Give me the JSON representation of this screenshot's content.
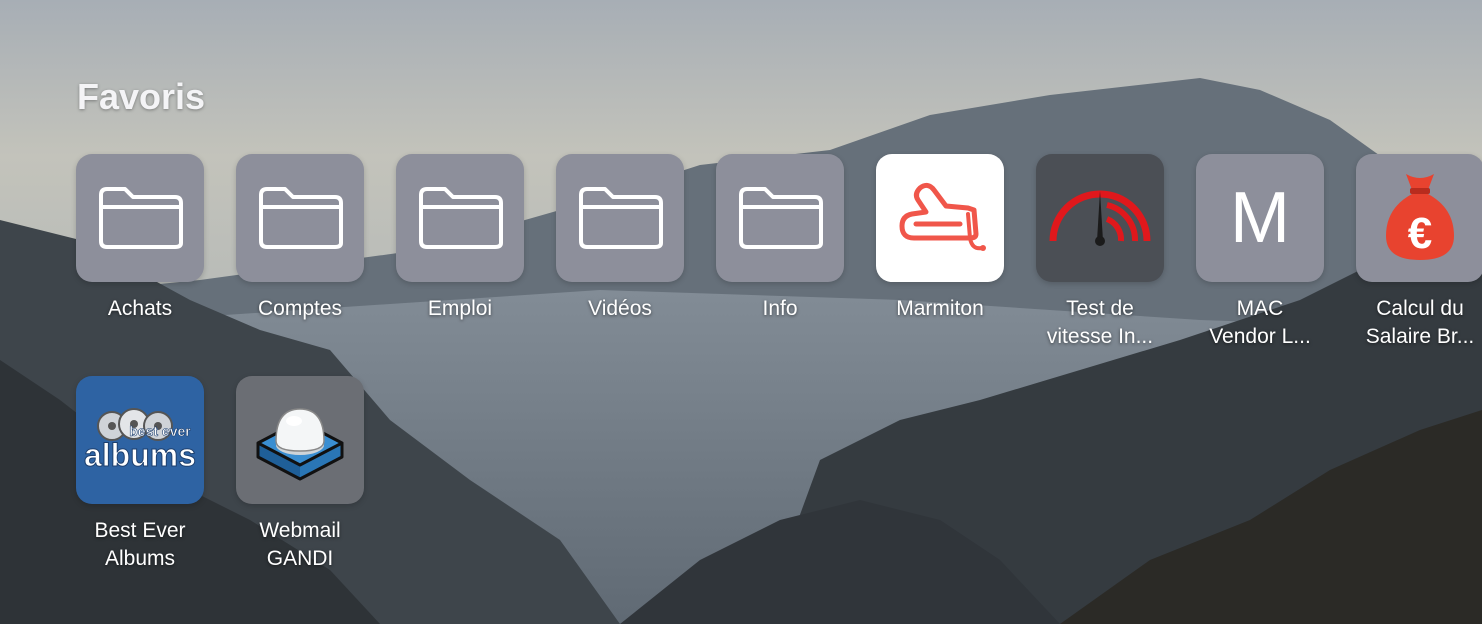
{
  "section": {
    "title": "Favoris"
  },
  "tiles": [
    {
      "label_line1": "Achats",
      "label_line2": "",
      "icon": "folder-icon"
    },
    {
      "label_line1": "Comptes",
      "label_line2": "",
      "icon": "folder-icon"
    },
    {
      "label_line1": "Emploi",
      "label_line2": "",
      "icon": "folder-icon"
    },
    {
      "label_line1": "Vidéos",
      "label_line2": "",
      "icon": "folder-icon"
    },
    {
      "label_line1": "Info",
      "label_line2": "",
      "icon": "folder-icon"
    },
    {
      "label_line1": "Marmiton",
      "label_line2": "",
      "icon": "oven-mitt-icon"
    },
    {
      "label_line1": "Test de",
      "label_line2": "vitesse In...",
      "icon": "speedometer-icon"
    },
    {
      "label_line1": "MAC",
      "label_line2": "Vendor L...",
      "icon": "letter-icon",
      "letter": "M"
    },
    {
      "label_line1": "Calcul du",
      "label_line2": "Salaire Br...",
      "icon": "euro-money-bag-icon",
      "symbol": "€"
    },
    {
      "label_line1": "Best Ever",
      "label_line2": "Albums",
      "icon": "albums-logo-icon",
      "logo_top": "best ever",
      "logo_bottom": "albums"
    },
    {
      "label_line1": "Webmail",
      "label_line2": "GANDI",
      "icon": "mailbox-icon"
    }
  ],
  "colors": {
    "tile_gray": "#8d8f9b",
    "marmiton_red": "#f0564a",
    "speed_red": "#e0181c",
    "money_bag": "#e8432f",
    "albums_blue": "#2e63a3"
  }
}
